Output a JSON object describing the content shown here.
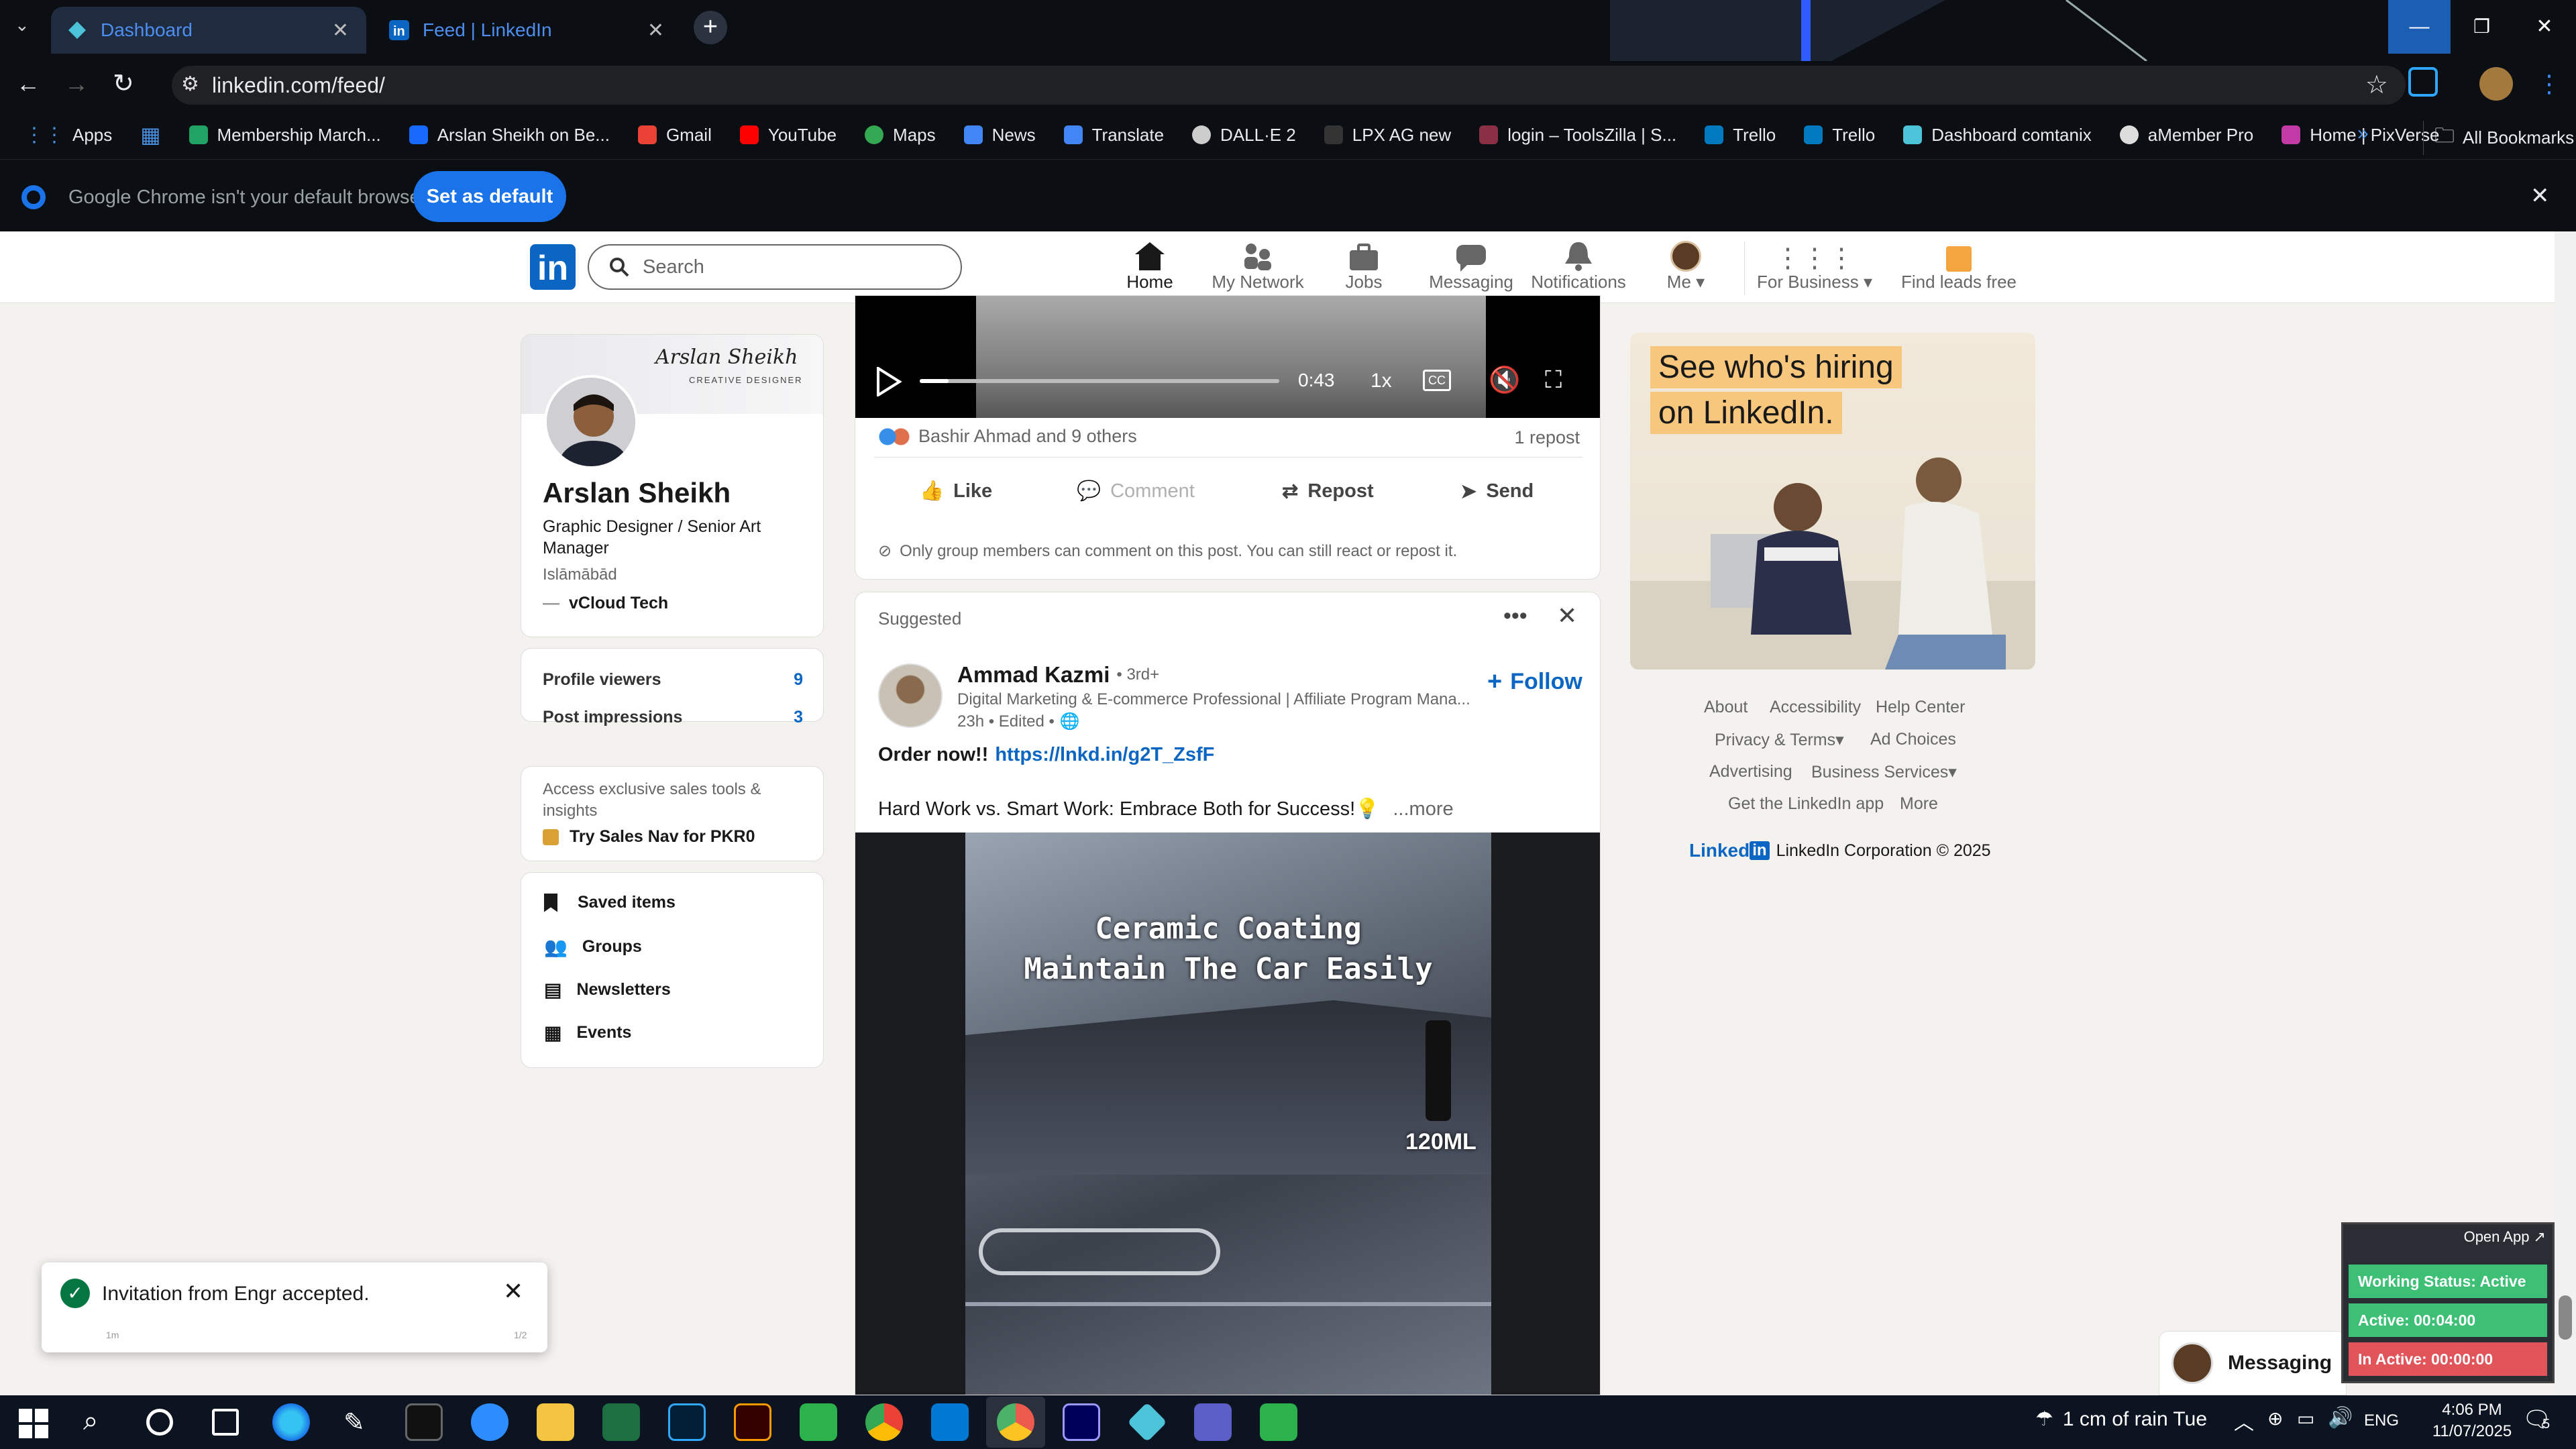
{
  "browser": {
    "tabs": [
      {
        "label": "Dashboard",
        "icon": "dashboard-icon"
      },
      {
        "label": "Feed | LinkedIn",
        "icon": "linkedin-icon"
      }
    ],
    "url": "linkedin.com/feed/",
    "bookmarks": [
      "Apps",
      "Membership March...",
      "Arslan Sheikh on Be...",
      "Gmail",
      "YouTube",
      "Maps",
      "News",
      "Translate",
      "DALL·E 2",
      "LPX AG new",
      "login – ToolsZilla | S...",
      "Trello",
      "Trello",
      "Dashboard comtanix",
      "aMember Pro",
      "Home | PixVerse"
    ],
    "all_bookmarks": "All Bookmarks",
    "infobar_text": "Google Chrome isn't your default browser",
    "set_default_label": "Set as default"
  },
  "linkedin_nav": {
    "search_placeholder": "Search",
    "items": [
      "Home",
      "My Network",
      "Jobs",
      "Messaging",
      "Notifications",
      "Me",
      "For Business",
      "Find leads free"
    ]
  },
  "profile": {
    "banner_name": "Arslan Sheikh",
    "banner_sub": "CREATIVE DESIGNER",
    "name": "Arslan Sheikh",
    "headline": "Graphic Designer / Senior Art Manager",
    "location": "Islāmābād",
    "company": "vCloud Tech",
    "stats": [
      {
        "label": "Profile viewers",
        "value": "9"
      },
      {
        "label": "Post impressions",
        "value": "3"
      }
    ],
    "premium_text": "Access exclusive sales tools & insights",
    "premium_cta": "Try Sales Nav for PKR0",
    "links": [
      "Saved items",
      "Groups",
      "Newsletters",
      "Events"
    ]
  },
  "post1": {
    "time": "0:43",
    "speed": "1x",
    "reactions": "Bashir Ahmad and 9 others",
    "reposts": "1 repost",
    "actions": [
      "Like",
      "Comment",
      "Repost",
      "Send"
    ],
    "notice": "Only group members can comment on this post. You can still react or repost it."
  },
  "post2": {
    "label": "Suggested",
    "author": "Ammad Kazmi",
    "degree": "• 3rd+",
    "subtitle": "Digital Marketing & E-commerce Professional | Affiliate Program Mana...",
    "meta": "23h • Edited •",
    "follow": "Follow",
    "text_bold": "Order now!!",
    "link": "https://lnkd.in/g2T_ZsfF",
    "text2": "Hard Work vs. Smart Work: Embrace Both for Success!💡",
    "more": "...more",
    "video_line1": "Ceramic Coating",
    "video_line2": "Maintain The Car Easily",
    "video_tag": "120ML"
  },
  "ad": {
    "line1": "See who's hiring",
    "line2": "on LinkedIn."
  },
  "footer": {
    "links": [
      "About",
      "Accessibility",
      "Help Center",
      "Privacy & Terms",
      "Ad Choices",
      "Advertising",
      "Business Services",
      "Get the LinkedIn app",
      "More"
    ],
    "brand": "Linked",
    "brand_in": "in",
    "copyright": "LinkedIn Corporation © 2025"
  },
  "toast": {
    "text": "Invitation from Engr accepted.",
    "left": "1m",
    "right": "1/2"
  },
  "messaging": {
    "label": "Messaging"
  },
  "tracker": {
    "open_app": "Open App ↗",
    "status": "Working Status: Active",
    "active": "Active: 00:04:00",
    "inactive": "In Active: 00:00:00"
  },
  "taskbar": {
    "weather": "1 cm of rain Tue",
    "lang": "ENG",
    "time": "4:06 PM",
    "date": "11/07/2025",
    "notif_count": "5"
  },
  "colors": {
    "linkedin_blue": "#0a66c2",
    "chrome_blue": "#1a73e8",
    "tracker_green": "#3dbf75",
    "tracker_red": "#e0545a"
  }
}
